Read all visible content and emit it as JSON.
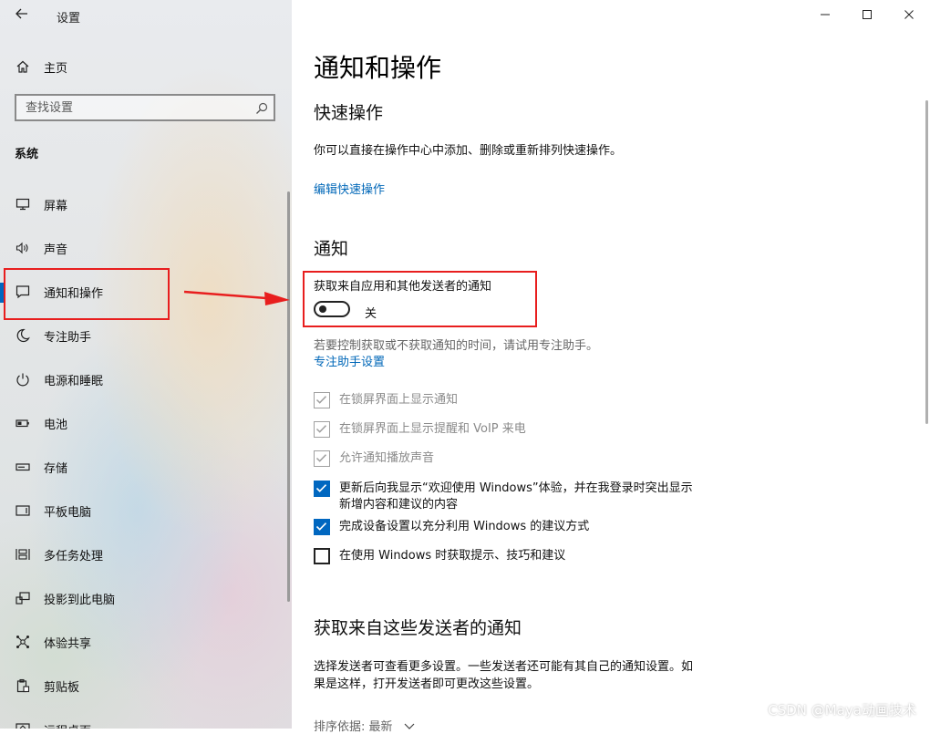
{
  "window": {
    "title": "设置",
    "controls": [
      "minimize",
      "maximize",
      "close"
    ]
  },
  "sidebar": {
    "home_label": "主页",
    "search_placeholder": "查找设置",
    "section_label": "系统",
    "items": [
      {
        "label": "屏幕",
        "icon": "monitor-icon"
      },
      {
        "label": "声音",
        "icon": "speaker-icon"
      },
      {
        "label": "通知和操作",
        "icon": "notification-icon",
        "selected": true
      },
      {
        "label": "专注助手",
        "icon": "moon-icon"
      },
      {
        "label": "电源和睡眠",
        "icon": "power-icon"
      },
      {
        "label": "电池",
        "icon": "battery-icon"
      },
      {
        "label": "存储",
        "icon": "storage-icon"
      },
      {
        "label": "平板电脑",
        "icon": "tablet-icon"
      },
      {
        "label": "多任务处理",
        "icon": "multitask-icon"
      },
      {
        "label": "投影到此电脑",
        "icon": "project-icon"
      },
      {
        "label": "体验共享",
        "icon": "share-icon"
      },
      {
        "label": "剪贴板",
        "icon": "clipboard-icon"
      },
      {
        "label": "远程桌面",
        "icon": "remote-desktop-icon"
      }
    ]
  },
  "main": {
    "page_title": "通知和操作",
    "quick_actions": {
      "heading": "快速操作",
      "description": "你可以直接在操作中心中添加、删除或重新排列快速操作。",
      "edit_link": "编辑快速操作"
    },
    "notifications": {
      "heading": "通知",
      "toggle_label": "获取来自应用和其他发送者的通知",
      "toggle_state": "关",
      "toggle_on": false,
      "focus_hint": "若要控制获取或不获取通知的时间，请试用专注助手。",
      "focus_link": "专注助手设置",
      "checkboxes": [
        {
          "line1": "在锁屏界面上显示通知",
          "line2": "",
          "checked": true,
          "disabled": true
        },
        {
          "line1": "在锁屏界面上显示提醒和 VoIP 来电",
          "line2": "",
          "checked": true,
          "disabled": true
        },
        {
          "line1": "允许通知播放声音",
          "line2": "",
          "checked": true,
          "disabled": true
        },
        {
          "line1": "更新后向我显示“欢迎使用 Windows”体验，并在我登录时突出显示",
          "line2": "新增内容和建议的内容",
          "checked": true,
          "disabled": false
        },
        {
          "line1": "完成设备设置以充分利用 Windows 的建议方式",
          "line2": "",
          "checked": true,
          "disabled": false
        },
        {
          "line1": "在使用 Windows 时获取提示、技巧和建议",
          "line2": "",
          "checked": false,
          "disabled": false
        }
      ]
    },
    "senders": {
      "heading": "获取来自这些发送者的通知",
      "desc_line1": "选择发送者可查看更多设置。一些发送者还可能有其自己的通知设置。如",
      "desc_line2": "果是这样，打开发送者即可更改这些设置。",
      "sort_label": "排序依据:",
      "sort_value": "最新"
    }
  },
  "watermark": "CSDN @Maya动画技术",
  "colors": {
    "accent": "#0067c0",
    "link": "#0067b8",
    "annotation": "#e81e1e"
  }
}
